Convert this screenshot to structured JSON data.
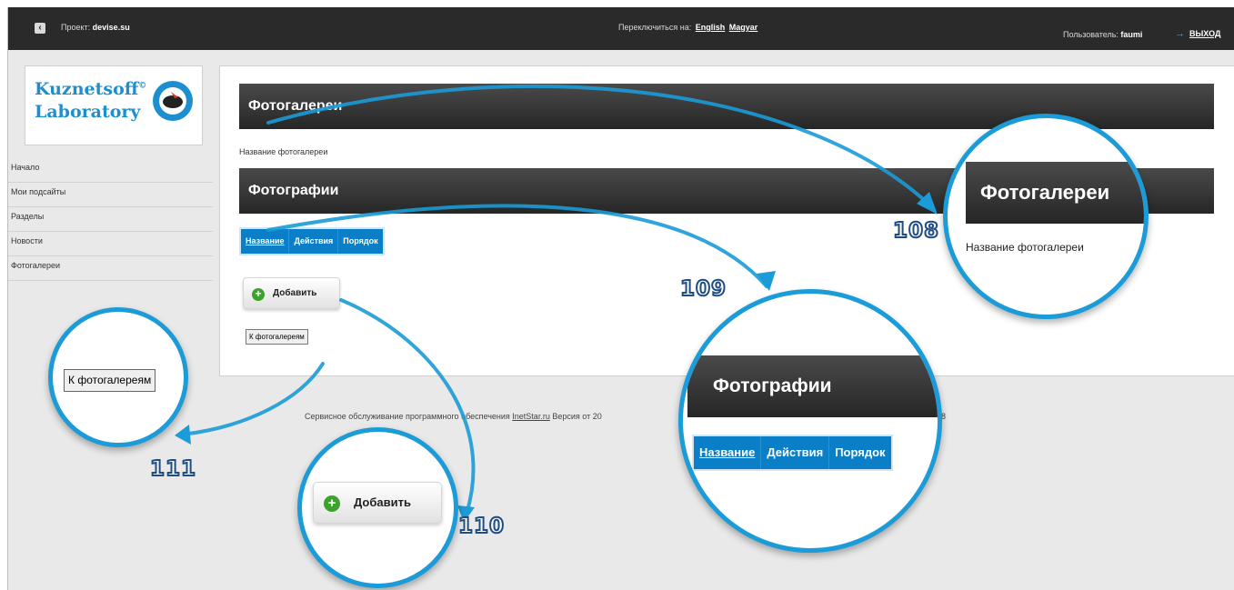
{
  "topbar": {
    "project_label": "Проект:",
    "project_name": "devise.su",
    "switch_label": "Переключиться на:",
    "lang_en": "English",
    "lang_hu": "Magyar",
    "user_label": "Пользователь:",
    "user_name": "faumi",
    "logout": "ВЫХОД"
  },
  "logo": {
    "line1": "Kuznetsoff",
    "mark": "©",
    "line2": "Laboratory"
  },
  "sidebar": {
    "items": [
      {
        "label": "Начало"
      },
      {
        "label": "Мои подсайты"
      },
      {
        "label": "Разделы"
      },
      {
        "label": "Новости"
      },
      {
        "label": "Фотогалереи"
      }
    ]
  },
  "main": {
    "galleries_header": "Фотогалереи",
    "gallery_name_label": "Название фотогалереи",
    "photos_header": "Фотографии",
    "tabs": [
      {
        "label": "Название"
      },
      {
        "label": "Действия"
      },
      {
        "label": "Порядок"
      }
    ],
    "add_button": "Добавить",
    "back_button": "К фотогалереям"
  },
  "footer": {
    "text": "Сервисное обслуживание программного обеспечения",
    "link": "InetStar.ru",
    "version_label": "Версия от 20",
    "tail": "58"
  },
  "callouts": {
    "n108": "108",
    "n109": "109",
    "n110": "110",
    "n111": "111"
  },
  "colors": {
    "accent": "#1b9bd7",
    "tab_bg": "#0a7fc7",
    "bar_dark": "#2a2a2a",
    "plus_green": "#3aa329"
  }
}
